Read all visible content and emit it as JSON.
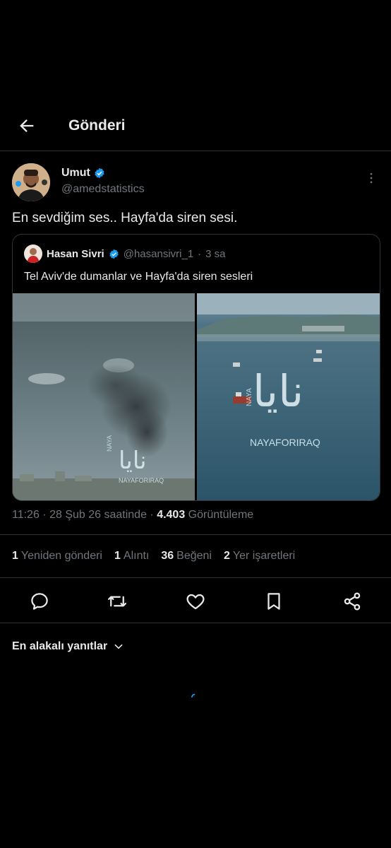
{
  "header": {
    "title": "Gönderi",
    "back_icon": "arrow-left-icon"
  },
  "tweet": {
    "author_name": "Umut",
    "author_handle": "@amedstatistics",
    "text": "En sevdiğim ses.. Hayfa'da siren sesi.",
    "verified_color": "#1d9bf0"
  },
  "quote": {
    "author_name": "Hasan Sivri",
    "author_handle": "@hasansivri_1",
    "separator": "·",
    "time": "3 sa",
    "text": "Tel Aviv'de dumanlar ve Hayfa'da siren sesleri",
    "media_watermark_text": "NAYAFORIRAQ"
  },
  "meta": {
    "time_date": "11:26 · 28 Şub 26 saatinde · ",
    "views_count": "4.403",
    "views_label": " Görüntüleme"
  },
  "stats": [
    {
      "count": "1",
      "label": "Yeniden gönderi"
    },
    {
      "count": "1",
      "label": "Alıntı"
    },
    {
      "count": "36",
      "label": "Beğeni"
    },
    {
      "count": "2",
      "label": "Yer işaretleri"
    }
  ],
  "actions": [
    "reply-icon",
    "retweet-icon",
    "like-icon",
    "bookmark-icon",
    "share-icon"
  ],
  "replies_sort": {
    "label": "En alakalı yanıtlar",
    "icon": "chevron-down-icon"
  },
  "colors": {
    "background": "#000000",
    "text": "#e7e9ea",
    "muted": "#71767b",
    "divider": "#2f3336",
    "accent": "#1d9bf0"
  }
}
